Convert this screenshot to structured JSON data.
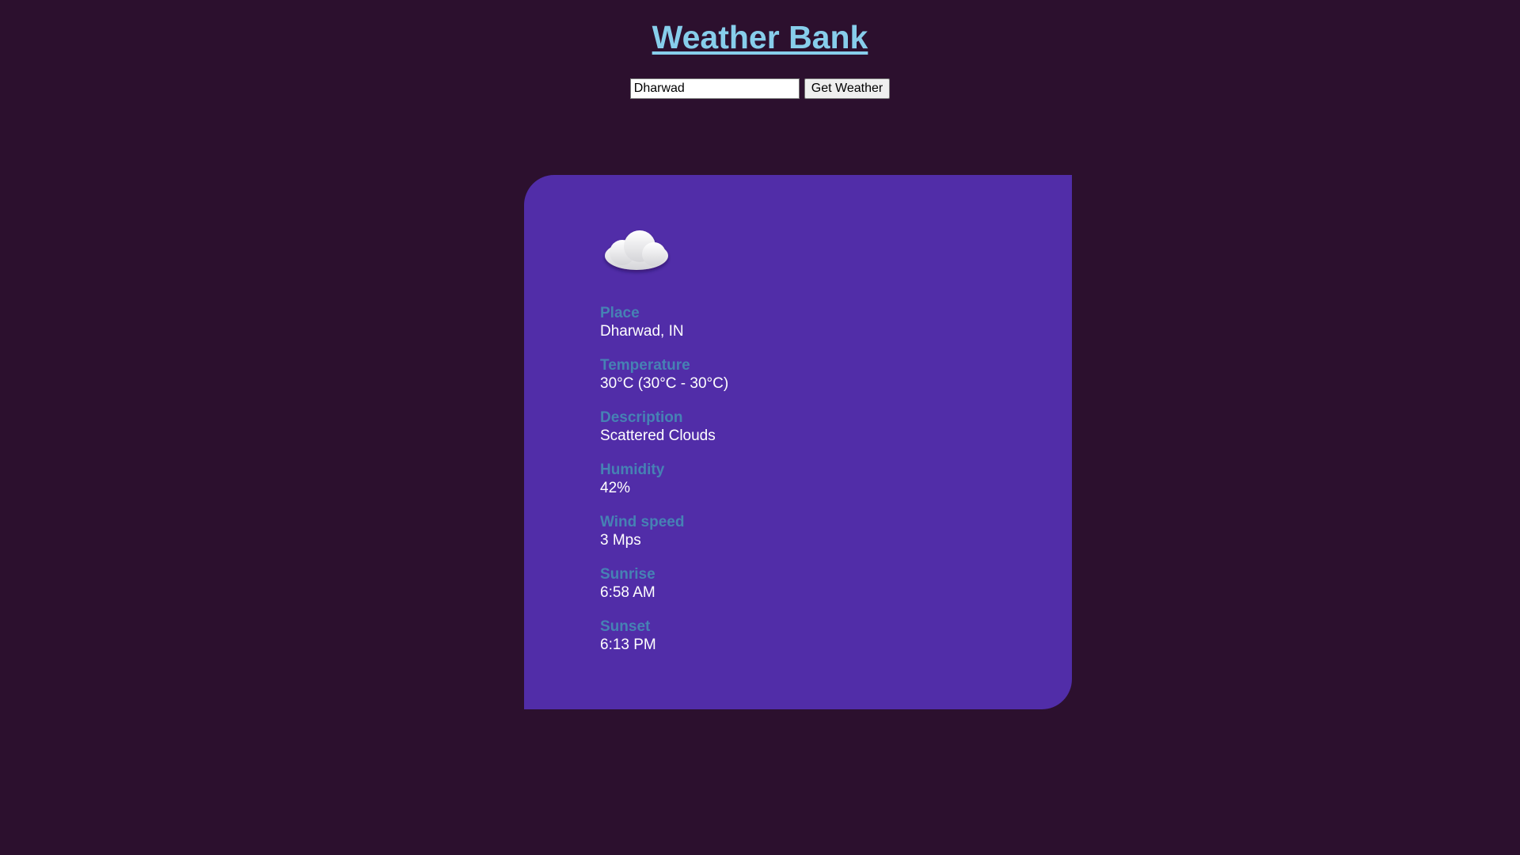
{
  "header": {
    "title": "Weather Bank"
  },
  "search": {
    "value": "Dharwad",
    "button_label": "Get Weather"
  },
  "weather": {
    "icon": "cloud-icon",
    "fields": [
      {
        "label": "Place",
        "value": "Dharwad, IN"
      },
      {
        "label": "Temperature",
        "value": "30°C (30°C - 30°C)"
      },
      {
        "label": "Description",
        "value": "Scattered Clouds"
      },
      {
        "label": "Humidity",
        "value": "42%"
      },
      {
        "label": "Wind speed",
        "value": "3 Mps"
      },
      {
        "label": "Sunrise",
        "value": "6:58 AM"
      },
      {
        "label": "Sunset",
        "value": "6:13 PM"
      }
    ]
  },
  "colors": {
    "background": "#2c102e",
    "card": "#512da8",
    "title": "#87ceeb",
    "label": "#4682b4",
    "value": "#ffffff"
  }
}
